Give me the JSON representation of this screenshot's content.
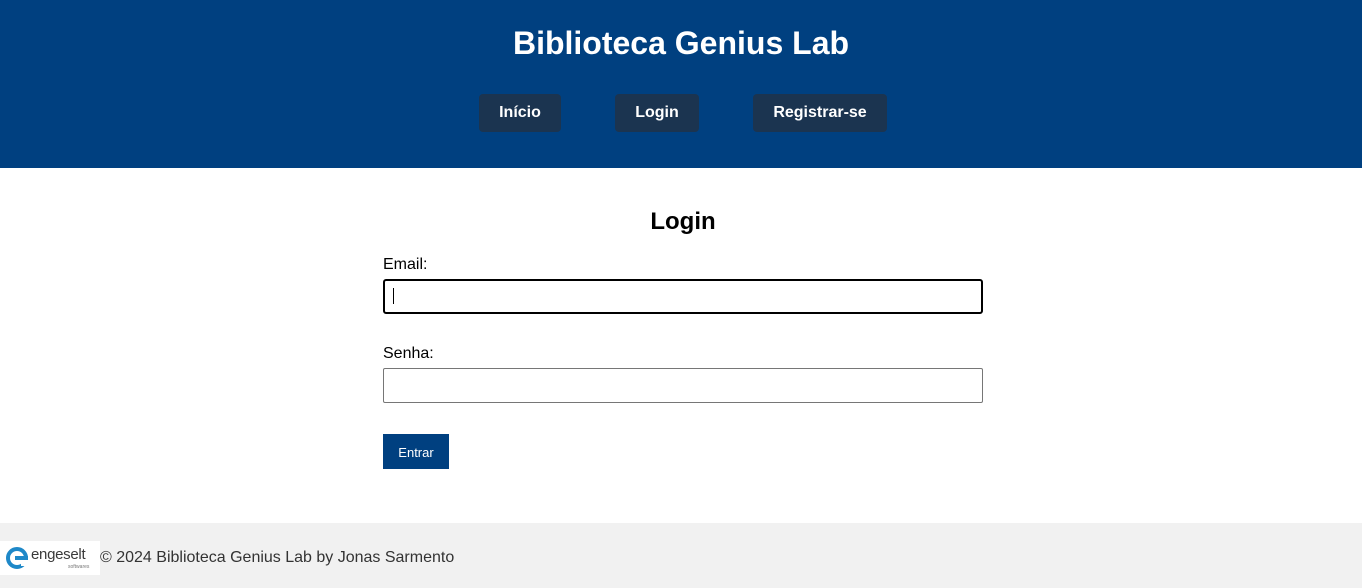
{
  "header": {
    "title": "Biblioteca Genius Lab",
    "nav": {
      "inicio": "Início",
      "login": "Login",
      "registrar": "Registrar-se"
    }
  },
  "login_form": {
    "heading": "Login",
    "email_label": "Email:",
    "email_value": "",
    "senha_label": "Senha:",
    "senha_value": "",
    "submit_label": "Entrar"
  },
  "footer": {
    "logo": {
      "icon": "engeselt-logo-icon",
      "word": "engeselt",
      "sub": "softwares"
    },
    "text": "© 2024 Biblioteca Genius Lab by Jonas Sarmento"
  },
  "colors": {
    "header_bg": "#004080",
    "nav_button_bg": "#1b3450",
    "submit_bg": "#004080",
    "footer_bg": "#f1f1f1",
    "logo_accent": "#1e88c8"
  }
}
